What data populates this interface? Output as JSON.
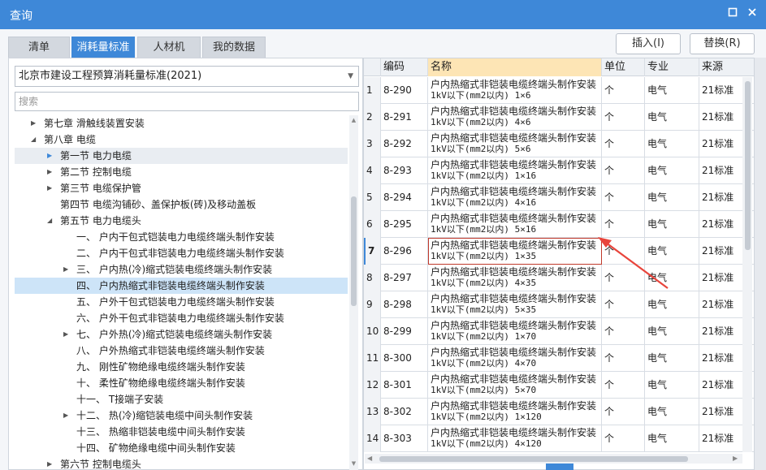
{
  "window": {
    "title": "查询",
    "min_icon": "restore-icon",
    "close_icon": "close-icon"
  },
  "tabs": [
    {
      "label": "清单",
      "active": false
    },
    {
      "label": "消耗量标准",
      "active": true
    },
    {
      "label": "人材机",
      "active": false
    },
    {
      "label": "我的数据",
      "active": false
    }
  ],
  "actions": {
    "insert_label": "插入(I)",
    "replace_label": "替换(R)"
  },
  "left": {
    "standard_selected": "北京市建设工程预算消耗量标准(2021)",
    "search_placeholder": "搜索",
    "tree": [
      {
        "label": "第七章  滑触线装置安装",
        "level": 1,
        "arrow": "right",
        "selected": false
      },
      {
        "label": "第八章  电缆",
        "level": 1,
        "arrow": "down",
        "selected": false
      },
      {
        "label": "第一节  电力电缆",
        "level": 2,
        "arrow": "right-blue",
        "selected": false,
        "shaded": true
      },
      {
        "label": "第二节  控制电缆",
        "level": 2,
        "arrow": "right",
        "selected": false
      },
      {
        "label": "第三节  电缆保护管",
        "level": 2,
        "arrow": "right",
        "selected": false
      },
      {
        "label": "第四节  电缆沟铺砂、盖保护板(砖)及移动盖板",
        "level": 2,
        "arrow": "",
        "selected": false
      },
      {
        "label": "第五节  电力电缆头",
        "level": 2,
        "arrow": "down",
        "selected": false
      },
      {
        "label": "一、  户内干包式铠装电力电缆终端头制作安装",
        "level": 3,
        "arrow": "",
        "selected": false
      },
      {
        "label": "二、  户内干包式非铠装电力电缆终端头制作安装",
        "level": 3,
        "arrow": "",
        "selected": false
      },
      {
        "label": "三、  户内热(冷)缩式铠装电缆终端头制作安装",
        "level": 3,
        "arrow": "right",
        "selected": false
      },
      {
        "label": "四、  户内热缩式非铠装电缆终端头制作安装",
        "level": 3,
        "arrow": "",
        "selected": true
      },
      {
        "label": "五、  户外干包式铠装电力电缆终端头制作安装",
        "level": 3,
        "arrow": "",
        "selected": false
      },
      {
        "label": "六、  户外干包式非铠装电力电缆终端头制作安装",
        "level": 3,
        "arrow": "",
        "selected": false
      },
      {
        "label": "七、  户外热(冷)缩式铠装电缆终端头制作安装",
        "level": 3,
        "arrow": "right",
        "selected": false
      },
      {
        "label": "八、  户外热缩式非铠装电缆终端头制作安装",
        "level": 3,
        "arrow": "",
        "selected": false
      },
      {
        "label": "九、  刚性矿物绝缘电缆终端头制作安装",
        "level": 3,
        "arrow": "",
        "selected": false
      },
      {
        "label": "十、  柔性矿物绝缘电缆终端头制作安装",
        "level": 3,
        "arrow": "",
        "selected": false
      },
      {
        "label": "十一、  T接端子安装",
        "level": 3,
        "arrow": "",
        "selected": false
      },
      {
        "label": "十二、  热(冷)缩铠装电缆中间头制作安装",
        "level": 3,
        "arrow": "right",
        "selected": false
      },
      {
        "label": "十三、  热缩非铠装电缆中间头制作安装",
        "level": 3,
        "arrow": "",
        "selected": false
      },
      {
        "label": "十四、  矿物绝缘电缆中间头制作安装",
        "level": 3,
        "arrow": "",
        "selected": false
      },
      {
        "label": "第六节  控制电缆头",
        "level": 2,
        "arrow": "right",
        "selected": false
      }
    ]
  },
  "grid": {
    "headers": {
      "code": "编码",
      "name": "名称",
      "unit": "单位",
      "specialty": "专业",
      "source": "来源"
    },
    "rows": [
      {
        "idx": "1",
        "code": "8-290",
        "name1": "户内热缩式非铠装电缆终端头制作安装",
        "name2": "1kV以下(mm2以内) 1×6",
        "unit": "个",
        "specialty": "电气",
        "source": "21标准"
      },
      {
        "idx": "2",
        "code": "8-291",
        "name1": "户内热缩式非铠装电缆终端头制作安装",
        "name2": "1kV以下(mm2以内) 4×6",
        "unit": "个",
        "specialty": "电气",
        "source": "21标准"
      },
      {
        "idx": "3",
        "code": "8-292",
        "name1": "户内热缩式非铠装电缆终端头制作安装",
        "name2": "1kV以下(mm2以内) 5×6",
        "unit": "个",
        "specialty": "电气",
        "source": "21标准"
      },
      {
        "idx": "4",
        "code": "8-293",
        "name1": "户内热缩式非铠装电缆终端头制作安装",
        "name2": "1kV以下(mm2以内) 1×16",
        "unit": "个",
        "specialty": "电气",
        "source": "21标准"
      },
      {
        "idx": "5",
        "code": "8-294",
        "name1": "户内热缩式非铠装电缆终端头制作安装",
        "name2": "1kV以下(mm2以内) 4×16",
        "unit": "个",
        "specialty": "电气",
        "source": "21标准"
      },
      {
        "idx": "6",
        "code": "8-295",
        "name1": "户内热缩式非铠装电缆终端头制作安装",
        "name2": "1kV以下(mm2以内) 5×16",
        "unit": "个",
        "specialty": "电气",
        "source": "21标准"
      },
      {
        "idx": "7",
        "code": "8-296",
        "name1": "户内热缩式非铠装电缆终端头制作安装",
        "name2": "1kV以下(mm2以内) 1×35",
        "unit": "个",
        "specialty": "电气",
        "source": "21标准",
        "current": true
      },
      {
        "idx": "8",
        "code": "8-297",
        "name1": "户内热缩式非铠装电缆终端头制作安装",
        "name2": "1kV以下(mm2以内) 4×35",
        "unit": "个",
        "specialty": "电气",
        "source": "21标准"
      },
      {
        "idx": "9",
        "code": "8-298",
        "name1": "户内热缩式非铠装电缆终端头制作安装",
        "name2": "1kV以下(mm2以内) 5×35",
        "unit": "个",
        "specialty": "电气",
        "source": "21标准"
      },
      {
        "idx": "10",
        "code": "8-299",
        "name1": "户内热缩式非铠装电缆终端头制作安装",
        "name2": "1kV以下(mm2以内) 1×70",
        "unit": "个",
        "specialty": "电气",
        "source": "21标准"
      },
      {
        "idx": "11",
        "code": "8-300",
        "name1": "户内热缩式非铠装电缆终端头制作安装",
        "name2": "1kV以下(mm2以内) 4×70",
        "unit": "个",
        "specialty": "电气",
        "source": "21标准"
      },
      {
        "idx": "12",
        "code": "8-301",
        "name1": "户内热缩式非铠装电缆终端头制作安装",
        "name2": "1kV以下(mm2以内) 5×70",
        "unit": "个",
        "specialty": "电气",
        "source": "21标准"
      },
      {
        "idx": "13",
        "code": "8-302",
        "name1": "户内热缩式非铠装电缆终端头制作安装",
        "name2": "1kV以下(mm2以内) 1×120",
        "unit": "个",
        "specialty": "电气",
        "source": "21标准"
      },
      {
        "idx": "14",
        "code": "8-303",
        "name1": "户内热缩式非铠装电缆终端头制作安装",
        "name2": "1kV以下(mm2以内) 4×120",
        "unit": "个",
        "specialty": "电气",
        "source": "21标准"
      }
    ]
  },
  "colors": {
    "accent": "#3e88d8",
    "selected_row": "#cde4f8",
    "name_header": "#fde5b5",
    "annotation_arrow": "#e8453c"
  }
}
